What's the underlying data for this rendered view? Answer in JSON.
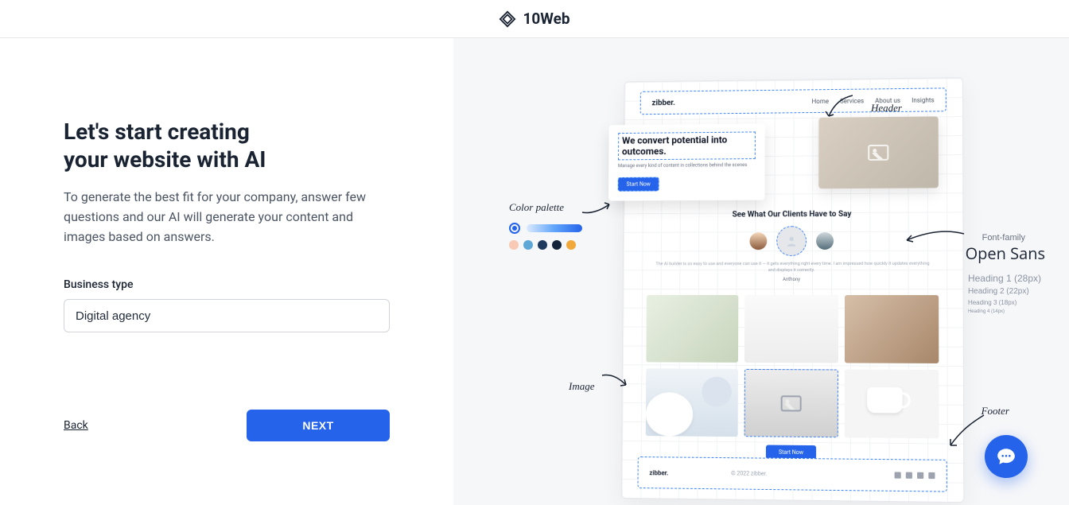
{
  "brand": "10Web",
  "left": {
    "heading_line1": "Let's start creating",
    "heading_line2": "your website with AI",
    "subtext": "To generate the best fit for your company, answer few questions and our AI will generate your content and images based on answers.",
    "field_label": "Business type",
    "field_value": "Digital agency",
    "back_label": "Back",
    "next_label": "NEXT"
  },
  "annotations": {
    "header": "Header",
    "footer": "Footer",
    "color_palette": "Color palette",
    "image": "Image",
    "font_family_label": "Font-family",
    "font_family_name": "Open Sans",
    "headings": [
      "Heading 1 (28px)",
      "Heading 2 (22px)",
      "Heading 3 (18px)",
      "Heading 4 (14px)"
    ]
  },
  "palette_colors": [
    "#f8c9b4",
    "#5ea7d6",
    "#1e3a5f",
    "#14243a",
    "#f2a93b"
  ],
  "mockup": {
    "brand": "zibber.",
    "nav": [
      "Home",
      "Services",
      "About us",
      "Insights"
    ],
    "hero_title": "We convert potential into outcomes.",
    "hero_sub": "Manage every kind of content in collections behind the scenes",
    "hero_cta": "Start Now",
    "clients_title": "See What Our Clients Have to Say",
    "testimonial": "The AI builder is so easy to use and everyone can use it — it gets everything right every time. I am impressed how quickly it updates everything and displays it correctly.",
    "testimonial_name": "Anthony",
    "cta2": "Start Now",
    "copyright": "© 2022 zibber."
  }
}
